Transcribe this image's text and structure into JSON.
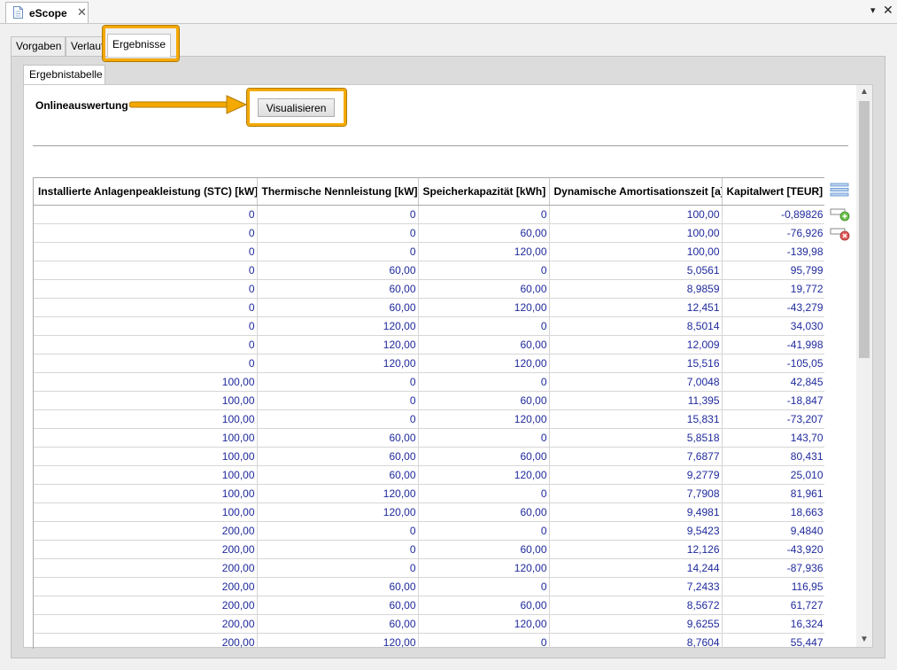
{
  "window": {
    "tab_title": "eScope",
    "close_glyph": "✕",
    "view_menu_glyph": "▾",
    "view_close_glyph": "✕"
  },
  "outer_tabs": [
    "Vorgaben",
    "Verlauf",
    "Ergebnisse"
  ],
  "selected_outer_tab": "Ergebnisse",
  "inner_tab": "Ergebnistabelle",
  "online_label": "Onlineauswertung",
  "visualisieren_label": "Visualisieren",
  "table": {
    "columns": [
      "Installierte Anlagenpeakleistung (STC) [kW]",
      "Thermische Nennleistung [kW]",
      "Speicherkapazität [kWh]",
      "Dynamische Amortisationszeit [a]",
      "Kapitalwert [TEUR]"
    ],
    "rows": [
      [
        "0",
        "0",
        "0",
        "100,00",
        "-0,89826"
      ],
      [
        "0",
        "0",
        "60,00",
        "100,00",
        "-76,926"
      ],
      [
        "0",
        "0",
        "120,00",
        "100,00",
        "-139,98"
      ],
      [
        "0",
        "60,00",
        "0",
        "5,0561",
        "95,799"
      ],
      [
        "0",
        "60,00",
        "60,00",
        "8,9859",
        "19,772"
      ],
      [
        "0",
        "60,00",
        "120,00",
        "12,451",
        "-43,279"
      ],
      [
        "0",
        "120,00",
        "0",
        "8,5014",
        "34,030"
      ],
      [
        "0",
        "120,00",
        "60,00",
        "12,009",
        "-41,998"
      ],
      [
        "0",
        "120,00",
        "120,00",
        "15,516",
        "-105,05"
      ],
      [
        "100,00",
        "0",
        "0",
        "7,0048",
        "42,845"
      ],
      [
        "100,00",
        "0",
        "60,00",
        "11,395",
        "-18,847"
      ],
      [
        "100,00",
        "0",
        "120,00",
        "15,831",
        "-73,207"
      ],
      [
        "100,00",
        "60,00",
        "0",
        "5,8518",
        "143,70"
      ],
      [
        "100,00",
        "60,00",
        "60,00",
        "7,6877",
        "80,431"
      ],
      [
        "100,00",
        "60,00",
        "120,00",
        "9,2779",
        "25,010"
      ],
      [
        "100,00",
        "120,00",
        "0",
        "7,7908",
        "81,961"
      ],
      [
        "100,00",
        "120,00",
        "60,00",
        "9,4981",
        "18,663"
      ],
      [
        "200,00",
        "0",
        "0",
        "9,5423",
        "9,4840"
      ],
      [
        "200,00",
        "0",
        "60,00",
        "12,126",
        "-43,920"
      ],
      [
        "200,00",
        "0",
        "120,00",
        "14,244",
        "-87,936"
      ],
      [
        "200,00",
        "60,00",
        "0",
        "7,2433",
        "116,95"
      ],
      [
        "200,00",
        "60,00",
        "60,00",
        "8,5672",
        "61,727"
      ],
      [
        "200,00",
        "60,00",
        "120,00",
        "9,6255",
        "16,324"
      ],
      [
        "200,00",
        "120,00",
        "0",
        "8,7604",
        "55,447"
      ]
    ]
  },
  "side_icons": [
    "column-toggle-icon",
    "add-row-icon",
    "remove-row-icon"
  ],
  "colors": {
    "highlight": "#f4a900",
    "cell_text": "#1f2a9c",
    "panel_bg": "#dcdcdc"
  }
}
